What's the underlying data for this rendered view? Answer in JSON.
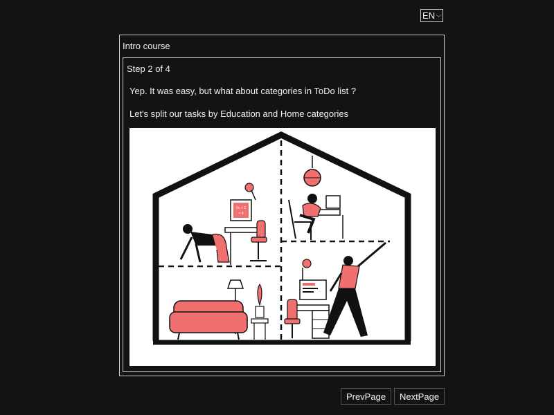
{
  "language": {
    "selected": "EN",
    "icon": "chevron-down-icon"
  },
  "dialog": {
    "title": "Intro course",
    "step": "Step 2 of 4",
    "text1": "Yep. It was easy, but what about categories in ToDo list ?",
    "text2": "Let's split our tasks by Education and Home categories",
    "illustration": {
      "board_text_1": "5x + 2",
      "board_text_2": "= 4"
    }
  },
  "nav": {
    "prev_label": "PrevPage",
    "next_label": "NextPage"
  },
  "colors": {
    "background": "#131313",
    "accent": "#f07070",
    "border": "#cfcfcf"
  }
}
